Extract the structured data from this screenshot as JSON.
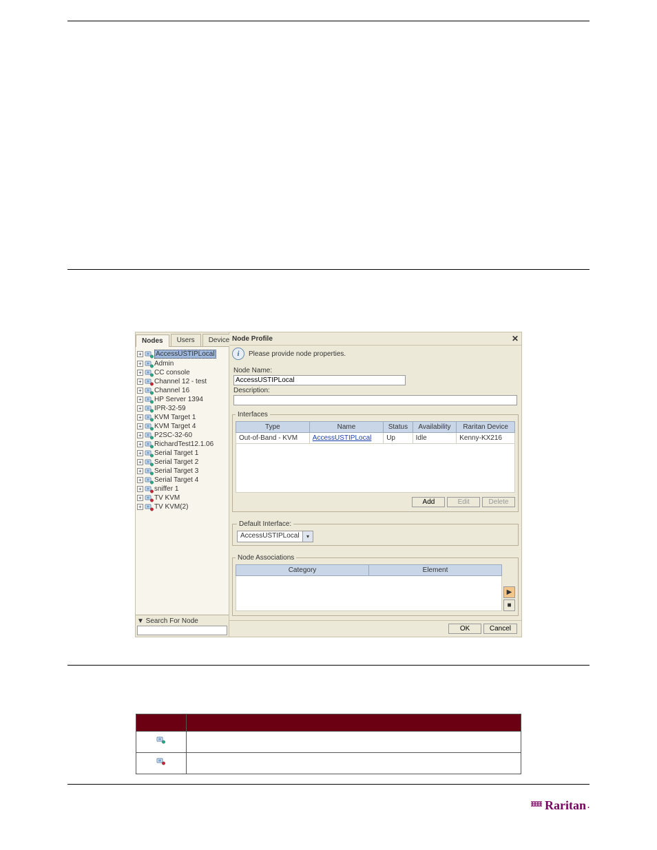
{
  "page": {
    "footer_brand": "Raritan"
  },
  "sidebar": {
    "tabs": [
      {
        "label": "Nodes",
        "active": true
      },
      {
        "label": "Users",
        "active": false
      },
      {
        "label": "Devices",
        "active": false
      }
    ],
    "items": [
      {
        "label": "AccessUSTIPLocal",
        "selected": true,
        "variant": "green"
      },
      {
        "label": "Admin",
        "variant": "green"
      },
      {
        "label": "CC console",
        "variant": "green"
      },
      {
        "label": "Channel 12 - test",
        "variant": "red"
      },
      {
        "label": "Channel 16",
        "variant": "green"
      },
      {
        "label": "HP Server 1394",
        "variant": "green"
      },
      {
        "label": "IPR-32-59",
        "variant": "green"
      },
      {
        "label": "KVM Target 1",
        "variant": "green"
      },
      {
        "label": "KVM Target 4",
        "variant": "green"
      },
      {
        "label": "P2SC-32-60",
        "variant": "green"
      },
      {
        "label": "RichardTest12.1.06",
        "variant": "green"
      },
      {
        "label": "Serial Target 1",
        "variant": "green"
      },
      {
        "label": "Serial Target 2",
        "variant": "green"
      },
      {
        "label": "Serial Target 3",
        "variant": "green"
      },
      {
        "label": "Serial Target 4",
        "variant": "green"
      },
      {
        "label": "sniffer 1",
        "variant": "red"
      },
      {
        "label": "TV KVM",
        "variant": "red"
      },
      {
        "label": "TV KVM(2)",
        "variant": "red"
      }
    ],
    "search_label": "▼ Search For Node",
    "search_value": ""
  },
  "panel": {
    "title": "Node Profile",
    "info": "Please provide node properties.",
    "name_label": "Node Name:",
    "name_value": "AccessUSTIPLocal",
    "desc_label": "Description:",
    "desc_value": "",
    "interfaces": {
      "legend": "Interfaces",
      "headers": [
        "Type",
        "Name",
        "Status",
        "Availability",
        "Raritan Device"
      ],
      "row": {
        "type": "Out-of-Band - KVM",
        "name": "AccessUSTIPLocal",
        "status": "Up",
        "availability": "Idle",
        "device": "Kenny-KX216"
      },
      "buttons": {
        "add": "Add",
        "edit": "Edit",
        "delete": "Delete"
      }
    },
    "default_if": {
      "legend": "Default Interface:",
      "value": "AccessUSTIPLocal"
    },
    "assoc": {
      "legend": "Node Associations",
      "headers": [
        "Category",
        "Element"
      ]
    },
    "footer": {
      "ok": "OK",
      "cancel": "Cancel"
    }
  },
  "legend_table": {
    "headers": [
      "",
      ""
    ],
    "rows": [
      {
        "variant": "green"
      },
      {
        "variant": "red"
      }
    ]
  }
}
